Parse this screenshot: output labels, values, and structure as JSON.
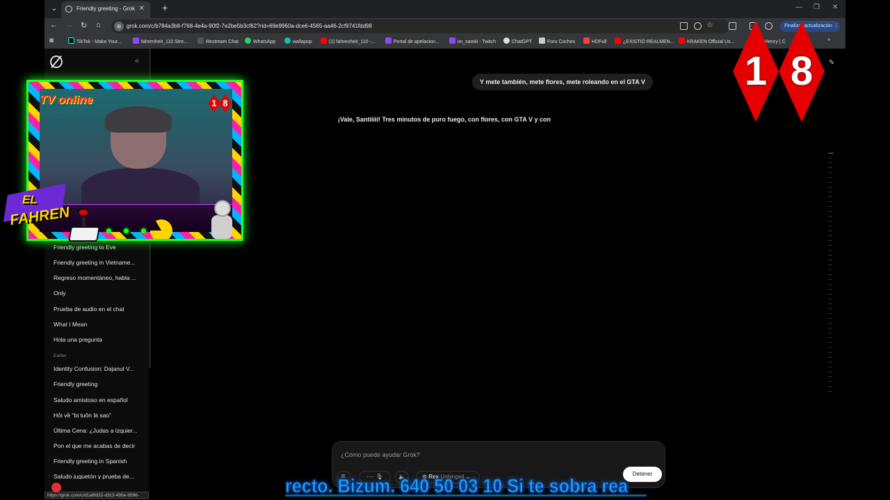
{
  "browser": {
    "tab_title": "Friendly greeting - Grok",
    "url": "grok.com/c/b784a3b8-f768-4e4a-90f2-7e2be5b3cf62?rid=69e9960a-dce6-4565-aa46-2cf9741fdd98",
    "update_button": "Finalizar actualización",
    "bookmarks": [
      "TikTok - Make Your...",
      "fahrenheit_110 Stre...",
      "Restream Chat",
      "WhatsApp",
      "wallapop",
      "(1) fahrenheit_110 -...",
      "Portal de apelacion...",
      "im_santiii - Twitch",
      "ChatGPT",
      "Foro Coches",
      "HDFull",
      "¿EXISTIÓ REALMEN...",
      "KRAKEN Official Us...",
      "ore Henry | C"
    ],
    "status_url": "https://grok.com/c/d1a6fd32-d3c3-495e-9596-9224cd3bb78a"
  },
  "sidebar": {
    "chats_recent": [
      "Friendly greeting to Eve",
      "Friendly greeting in Vietname...",
      "Regreso momentáneo, habla ...",
      "Only",
      "Prueba de audio en el chat",
      "What I Mean",
      "Hola una pregunta"
    ],
    "section_label": "Earlier",
    "chats_earlier": [
      "Identity Confusion: Dajanul V...",
      "Friendly greeting",
      "Saludo amistoso en español",
      "Hỏi về \"bị tuôn là sao\"",
      "Última Cena: ¿Judas a izquier...",
      "Pon el que me acabas de decir",
      "Friendly greeting in Spanish",
      "Saludo juguetón y prueba de..."
    ]
  },
  "conversation": {
    "user_message": "Y mete también, mete flores, mete roleando en el GTA V",
    "assistant_message": "¡Vale, Santiiiii! Tres minutos de puro fuego, con flores, con GTA V y con"
  },
  "composer": {
    "placeholder": "¿Cómo puede ayudar Grok?",
    "model_name": "Rex",
    "model_mode": "Unhinged",
    "stop_label": "Detener"
  },
  "overlay": {
    "tv_title": "TV online",
    "badge_1": "1",
    "badge_8": "8",
    "el": "EL",
    "fahren": "FAHREN",
    "ticker": "recto. Bizum. 640 50 03 10 Si te sobra rea"
  }
}
